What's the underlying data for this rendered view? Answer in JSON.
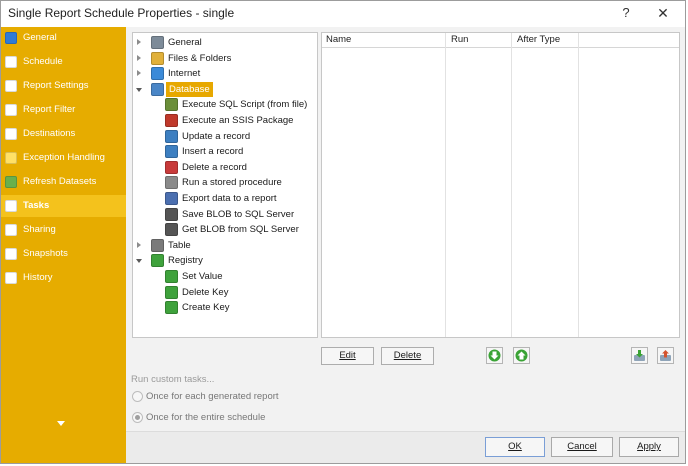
{
  "window": {
    "title": "Single Report Schedule Properties - single",
    "help_glyph": "?",
    "close_glyph": "✕"
  },
  "sidebar": {
    "items": [
      {
        "label": "General",
        "icon": "general-icon",
        "color": "#2f7bd6"
      },
      {
        "label": "Schedule",
        "icon": "clock-icon",
        "color": "#ffffff"
      },
      {
        "label": "Report Settings",
        "icon": "report-settings-icon",
        "color": "#ffffff"
      },
      {
        "label": "Report Filter",
        "icon": "report-filter-icon",
        "color": "#ffffff"
      },
      {
        "label": "Destinations",
        "icon": "destinations-icon",
        "color": "#ffffff"
      },
      {
        "label": "Exception Handling",
        "icon": "warning-icon",
        "color": "#ffe066"
      },
      {
        "label": "Refresh Datasets",
        "icon": "refresh-icon",
        "color": "#6ab04c"
      },
      {
        "label": "Tasks",
        "icon": "tasks-icon",
        "color": "#ffffff",
        "active": true
      },
      {
        "label": "Sharing",
        "icon": "sharing-icon",
        "color": "#ffffff"
      },
      {
        "label": "Snapshots",
        "icon": "snapshots-icon",
        "color": "#ffffff"
      },
      {
        "label": "History",
        "icon": "history-icon",
        "color": "#ffffff"
      }
    ],
    "more_icon": "chevron-down-icon"
  },
  "tree": {
    "nodes": [
      {
        "label": "General",
        "icon": "gear-folder-icon",
        "color": "#7d8b99",
        "expander": "collapsed"
      },
      {
        "label": "Files & Folders",
        "icon": "folder-icon",
        "color": "#e0b03a",
        "expander": "collapsed"
      },
      {
        "label": "Internet",
        "icon": "globe-icon",
        "color": "#3b8ad8",
        "expander": "collapsed"
      },
      {
        "label": "Database",
        "icon": "database-icon",
        "color": "#4a86c7",
        "expander": "expanded",
        "selected": true
      },
      {
        "label": "Execute SQL Script (from file)",
        "icon": "sql-script-icon",
        "color": "#6b8f3a"
      },
      {
        "label": "Execute an SSIS Package",
        "icon": "ssis-package-icon",
        "color": "#c0392b"
      },
      {
        "label": "Update a record",
        "icon": "update-record-icon",
        "color": "#3d7fc1"
      },
      {
        "label": "Insert a record",
        "icon": "insert-record-icon",
        "color": "#3d7fc1"
      },
      {
        "label": "Delete a record",
        "icon": "delete-record-icon",
        "color": "#c83a3a"
      },
      {
        "label": "Run a stored procedure",
        "icon": "stored-procedure-icon",
        "color": "#8a8a8a"
      },
      {
        "label": "Export data to a report",
        "icon": "export-report-icon",
        "color": "#4b6fb0"
      },
      {
        "label": "Save BLOB to SQL Server",
        "icon": "save-blob-icon",
        "color": "#555555"
      },
      {
        "label": "Get BLOB from SQL Server",
        "icon": "get-blob-icon",
        "color": "#555555"
      },
      {
        "label": "Table",
        "icon": "table-icon",
        "color": "#7a7a7a",
        "expander": "collapsed"
      },
      {
        "label": "Registry",
        "icon": "registry-icon",
        "color": "#3fa23c",
        "expander": "expanded"
      },
      {
        "label": "Set Value",
        "icon": "registry-set-icon",
        "color": "#3fa23c"
      },
      {
        "label": "Delete Key",
        "icon": "registry-delete-icon",
        "color": "#3fa23c"
      },
      {
        "label": "Create Key",
        "icon": "registry-create-icon",
        "color": "#3fa23c"
      }
    ]
  },
  "grid": {
    "columns": [
      "Name",
      "Run",
      "After Type"
    ]
  },
  "actions": {
    "edit_label": "Edit",
    "delete_label": "Delete",
    "move_down_icon": "arrow-down-icon",
    "move_up_icon": "arrow-up-icon",
    "import_icon": "import-icon",
    "export_icon": "export-icon",
    "arrow_color": "#3aa335"
  },
  "run_custom": {
    "label": "Run custom tasks...",
    "options": [
      {
        "label": "Once for each generated report",
        "selected": false
      },
      {
        "label": "Once for the entire schedule",
        "selected": true
      }
    ]
  },
  "footer": {
    "ok_label": "OK",
    "cancel_label": "Cancel",
    "apply_label": "Apply"
  },
  "colors": {
    "sidebar_bg": "#e6ac00",
    "sidebar_active": "#f4c21c",
    "selection": "#e7a800"
  }
}
